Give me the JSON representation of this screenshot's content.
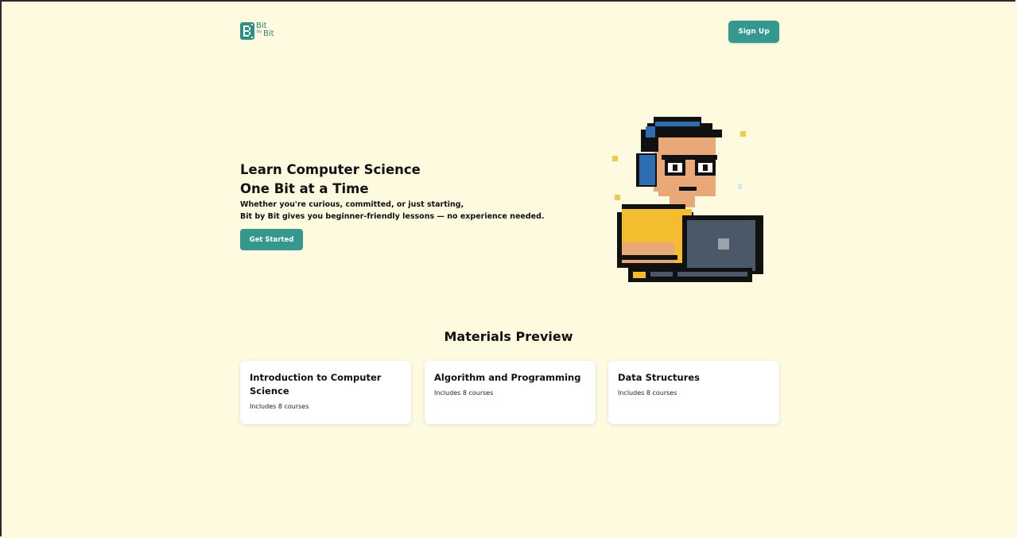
{
  "header": {
    "logo": {
      "line1": "Bit",
      "line2": "by",
      "line3": "Bit"
    },
    "signup_label": "Sign Up"
  },
  "hero": {
    "title_line1": "Learn Computer Science",
    "title_line2": "One Bit at a Time",
    "subtitle_line1": "Whether you're curious, committed, or just starting,",
    "subtitle_line2": "Bit by Bit gives you beginner-friendly lessons — no experience needed.",
    "cta_label": "Get Started"
  },
  "materials": {
    "title": "Materials Preview",
    "cards": [
      {
        "title": "Introduction to Computer Science",
        "subtitle": "Includes 8 courses"
      },
      {
        "title": "Algorithm and Programming",
        "subtitle": "Includes 8 courses"
      },
      {
        "title": "Data Structures",
        "subtitle": "Includes 8 courses"
      }
    ]
  },
  "colors": {
    "background": "#fdfadf",
    "accent": "#35988f",
    "card": "#ffffff"
  },
  "icons": {
    "logo": "bit-logo-icon",
    "illustration": "pixel-student-laptop-illustration"
  }
}
